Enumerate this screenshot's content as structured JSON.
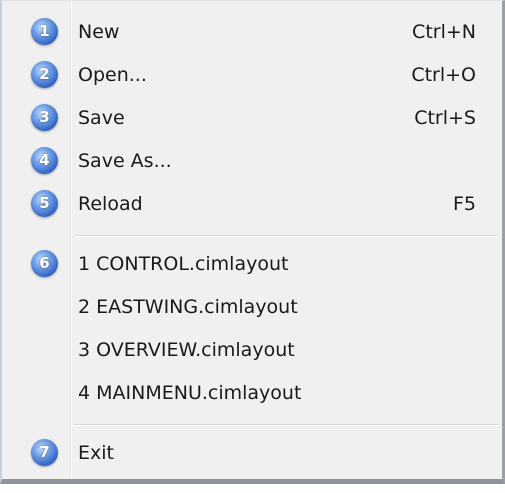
{
  "menu": {
    "items": [
      {
        "badge": "1",
        "label": "New",
        "shortcut": "Ctrl+N"
      },
      {
        "badge": "2",
        "label": "Open...",
        "shortcut": "Ctrl+O"
      },
      {
        "badge": "3",
        "label": "Save",
        "shortcut": "Ctrl+S"
      },
      {
        "badge": "4",
        "label": "Save As...",
        "shortcut": ""
      },
      {
        "badge": "5",
        "label": "Reload",
        "shortcut": "F5"
      }
    ],
    "recent": [
      {
        "badge": "6",
        "label": "1 CONTROL.cimlayout"
      },
      {
        "label": "2 EASTWING.cimlayout"
      },
      {
        "label": "3 OVERVIEW.cimlayout"
      },
      {
        "label": "4 MAINMENU.cimlayout"
      }
    ],
    "exit": {
      "badge": "7",
      "label": "Exit"
    }
  }
}
